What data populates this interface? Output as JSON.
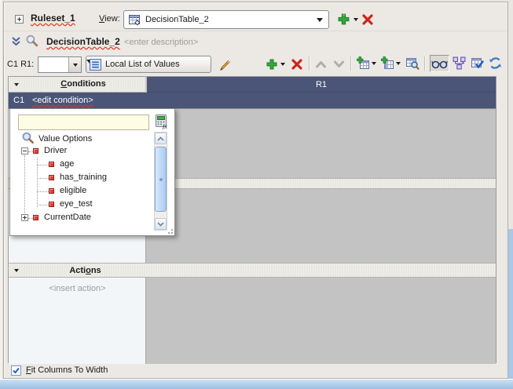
{
  "ruleset_bar": {
    "ruleset_name": "Ruleset_1",
    "view_label_mnemonic": "V",
    "view_label_rest": "iew:",
    "view_selected": "DecisionTable_2"
  },
  "table_bar": {
    "name": "DecisionTable_2",
    "description_placeholder": "<enter description>"
  },
  "toolbar": {
    "cell_label": "C1 R1:",
    "cell_value": "",
    "list_mode": "Local List of Values"
  },
  "grid": {
    "conditions_mnemonic": "C",
    "conditions_rest": "onditions",
    "rule_column": "R1",
    "condition_row_id": "C1",
    "condition_row_text": "<edit condition>",
    "actions_pre": "Acti",
    "actions_mnemonic": "o",
    "actions_rest": "ns",
    "insert_action": "<insert action>"
  },
  "popup": {
    "search_value": "",
    "root_label": "Value Options",
    "nodes": [
      {
        "label": "Driver",
        "state": "expanded"
      },
      {
        "label": "age",
        "state": "leaf"
      },
      {
        "label": "has_training",
        "state": "leaf"
      },
      {
        "label": "eligible",
        "state": "leaf"
      },
      {
        "label": "eye_test",
        "state": "leaf"
      },
      {
        "label": "CurrentDate",
        "state": "collapsed"
      }
    ]
  },
  "footer": {
    "fit_mnemonic": "F",
    "fit_rest": "it Columns To Width",
    "checked": true
  },
  "colors": {
    "header_blue": "#4a5578",
    "panel_bg": "#ece9e4",
    "grid_gray": "#c3c3c3",
    "section_header": "#e9e7e1",
    "accent_green": "#35a83b",
    "accent_red": "#cf2418",
    "frame_blue": "#a9c7e8",
    "field_yellow": "#fdfce5"
  },
  "icons": {
    "expand-ruleset-icon": "⊞",
    "add-icon": "green ✚",
    "delete-icon": "red ✖",
    "caret-down-icon": "▾",
    "collapse-chevrons-icon": "»",
    "search-icon": "🔍",
    "edit-pencil-icon": "✎",
    "list-icon": "≡",
    "move-up-icon": "∧",
    "move-down-icon": "∨",
    "add-row-table-icon": "table+",
    "add-column-table-icon": "table+",
    "find-cell-table-icon": "table🔍",
    "glasses-icon": "👓",
    "merge-cells-icon": "split boxes",
    "check-table-icon": "table✓",
    "refresh-icon": "↻",
    "calculator-fx-icon": "🖩fx",
    "tree-collapse-icon": "⊟",
    "tree-expand-icon": "⊞",
    "attribute-icon": "▪",
    "checkbox-check-icon": "✓"
  }
}
